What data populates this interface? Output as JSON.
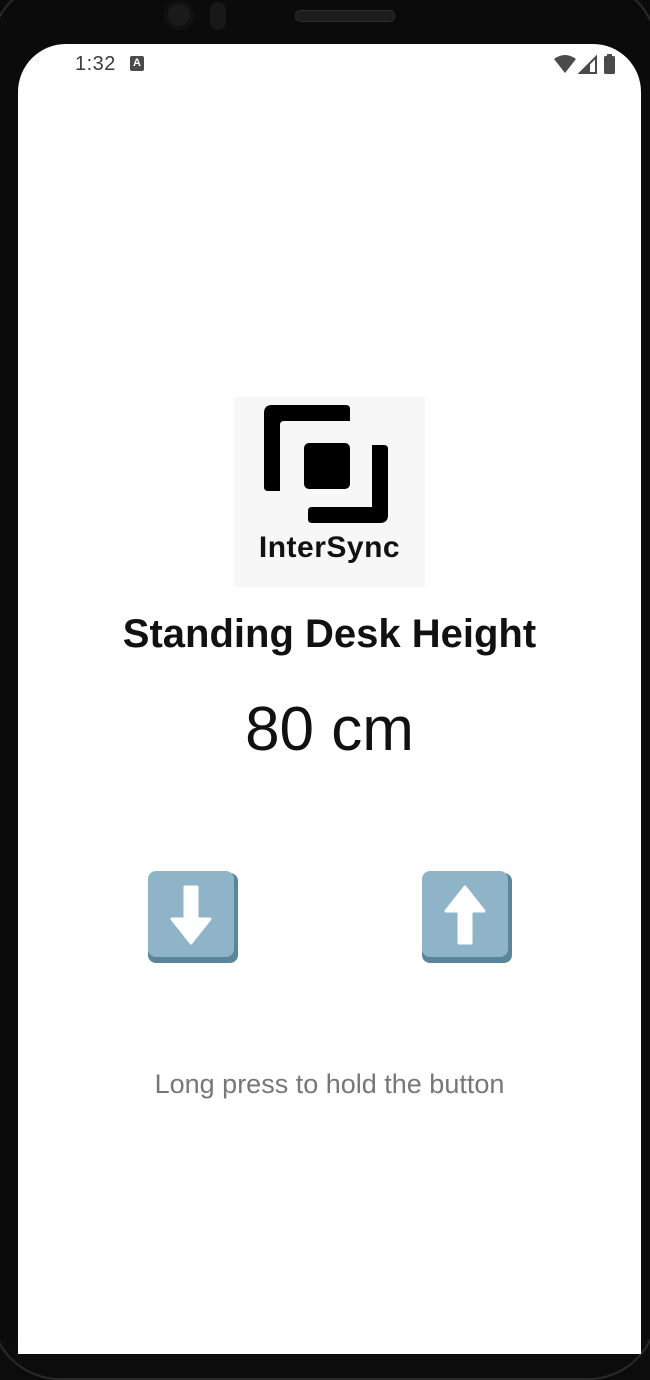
{
  "status_bar": {
    "time": "1:32",
    "notification_icon": "A",
    "icons": [
      "wifi-icon",
      "cell-signal-icon",
      "battery-icon"
    ]
  },
  "logo": {
    "text": "InterSync"
  },
  "main": {
    "title": "Standing Desk Height",
    "height_value": "80 cm",
    "down_button_icon": "arrow-down-icon",
    "up_button_icon": "arrow-up-icon",
    "hint": "Long press to hold the button"
  },
  "colors": {
    "button_face": "#8fb4c8",
    "button_edge": "#5a8699",
    "arrow": "#ffffff",
    "hint_text": "#777777"
  }
}
